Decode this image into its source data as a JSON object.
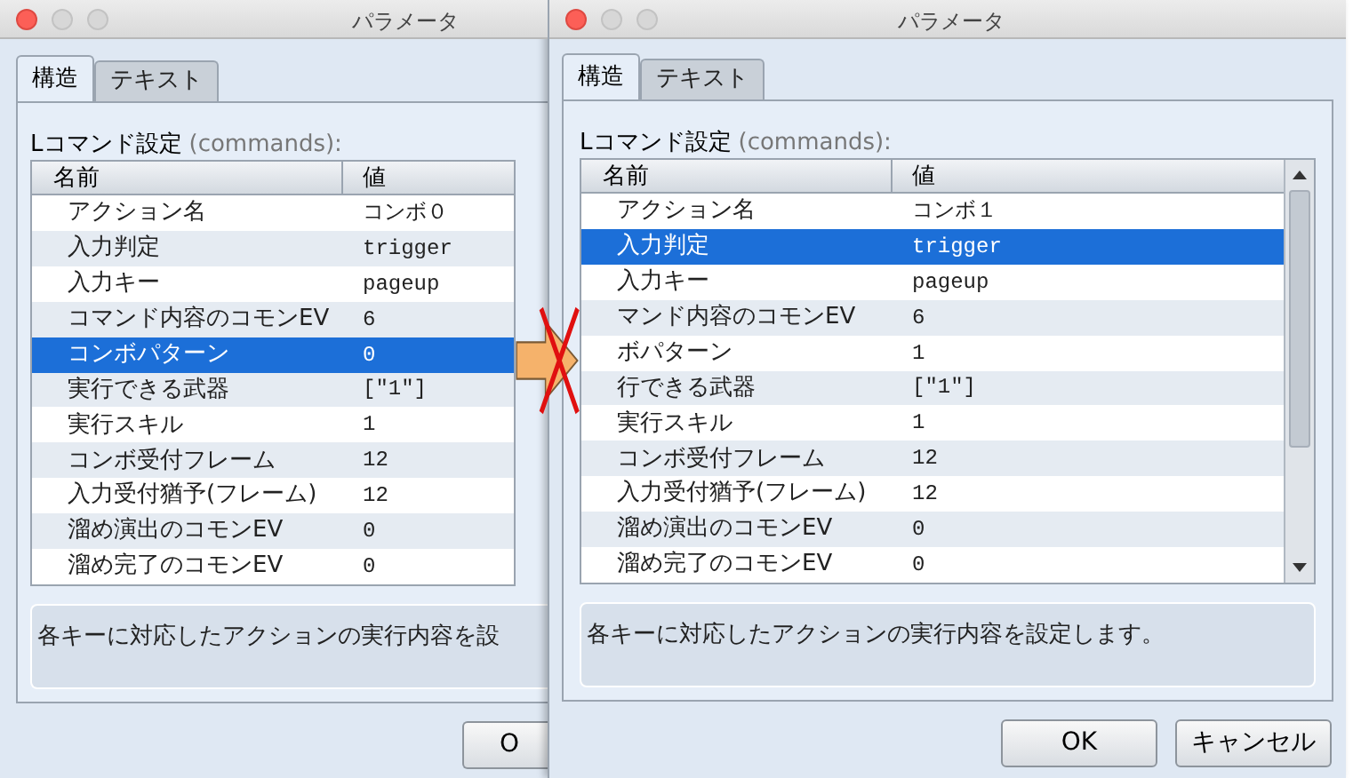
{
  "windows": [
    {
      "title": "パラメータ",
      "tabs": [
        {
          "label": "構造",
          "selected": true
        },
        {
          "label": "テキスト",
          "selected": false
        }
      ],
      "section_mark": "L",
      "section_label": "コマンド設定",
      "section_key": "(commands):",
      "columns": [
        "名前",
        "値"
      ],
      "rows": [
        {
          "name": "アクション名",
          "value": "コンボ０",
          "selected": false
        },
        {
          "name": "入力判定",
          "value": "trigger",
          "selected": false
        },
        {
          "name": "入力キー",
          "value": "pageup",
          "selected": false
        },
        {
          "name": "コマンド内容のコモンEV",
          "value": "6",
          "selected": false
        },
        {
          "name": "コンボパターン",
          "value": "0",
          "selected": true
        },
        {
          "name": "実行できる武器",
          "value": "[\"1\"]",
          "selected": false
        },
        {
          "name": "実行スキル",
          "value": "1",
          "selected": false
        },
        {
          "name": "コンボ受付フレーム",
          "value": "12",
          "selected": false
        },
        {
          "name": "入力受付猶予(フレーム)",
          "value": "12",
          "selected": false
        },
        {
          "name": "溜め演出のコモンEV",
          "value": "0",
          "selected": false
        },
        {
          "name": "溜め完了のコモンEV",
          "value": "0",
          "selected": false
        }
      ],
      "scrollbar": false,
      "description": "各キーに対応したアクションの実行内容を設",
      "buttons": [
        "O"
      ]
    },
    {
      "title": "パラメータ",
      "tabs": [
        {
          "label": "構造",
          "selected": true
        },
        {
          "label": "テキスト",
          "selected": false
        }
      ],
      "section_mark": "L",
      "section_label": "コマンド設定",
      "section_key": "(commands):",
      "columns": [
        "名前",
        "値"
      ],
      "rows": [
        {
          "name": "アクション名",
          "value": "コンボ１",
          "selected": false
        },
        {
          "name": "入力判定",
          "value": "trigger",
          "selected": true
        },
        {
          "name": "入力キー",
          "value": "pageup",
          "selected": false
        },
        {
          "name": "マンド内容のコモンEV",
          "value": "6",
          "selected": false
        },
        {
          "name": "ボパターン",
          "value": "1",
          "selected": false
        },
        {
          "name": "行できる武器",
          "value": "[\"1\"]",
          "selected": false
        },
        {
          "name": "実行スキル",
          "value": "1",
          "selected": false
        },
        {
          "name": "コンボ受付フレーム",
          "value": "12",
          "selected": false
        },
        {
          "name": "入力受付猶予(フレーム)",
          "value": "12",
          "selected": false
        },
        {
          "name": "溜め演出のコモンEV",
          "value": "0",
          "selected": false
        },
        {
          "name": "溜め完了のコモンEV",
          "value": "0",
          "selected": false
        }
      ],
      "scrollbar": true,
      "description": "各キーに対応したアクションの実行内容を設定します。",
      "buttons": [
        "OK",
        "キャンセル"
      ]
    }
  ]
}
